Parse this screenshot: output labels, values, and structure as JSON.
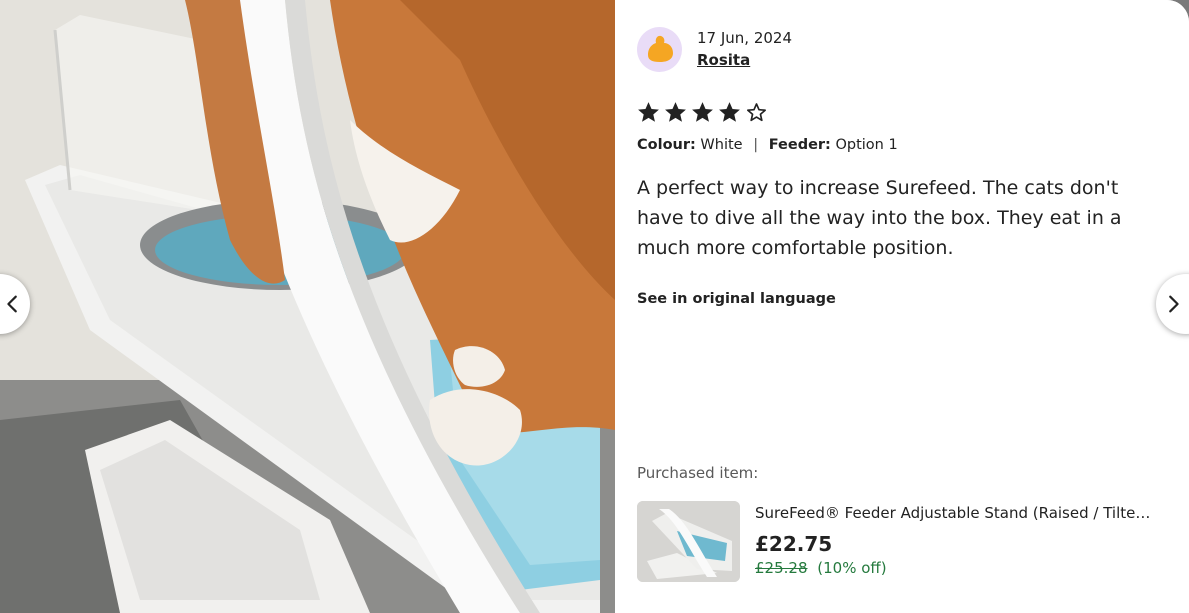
{
  "review": {
    "date": "17 Jun, 2024",
    "reviewer_name": "Rosita",
    "rating": 4,
    "rating_max": 5,
    "variations": {
      "colour_label": "Colour:",
      "colour_value": "White",
      "separator": "|",
      "feeder_label": "Feeder:",
      "feeder_value": "Option 1"
    },
    "text": "A perfect way to increase Surefeed. The cats don't have to dive all the way into the box. They eat in a much more comfortable position.",
    "see_original_label": "See in original language"
  },
  "purchased": {
    "label": "Purchased item:",
    "title": "SureFeed® Feeder Adjustable Stand (Raised / Tilte…",
    "price": "£22.75",
    "original_price": "£25.28",
    "discount": "(10% off)"
  },
  "colors": {
    "sale_green": "#257a3e",
    "avatar_bg": "#e9dcf7",
    "avatar_fg": "#f5a623",
    "text": "#222222"
  },
  "icons": {
    "prev": "chevron-left-icon",
    "next": "chevron-right-icon",
    "star_filled": "star-filled-icon",
    "star_empty": "star-empty-icon"
  }
}
